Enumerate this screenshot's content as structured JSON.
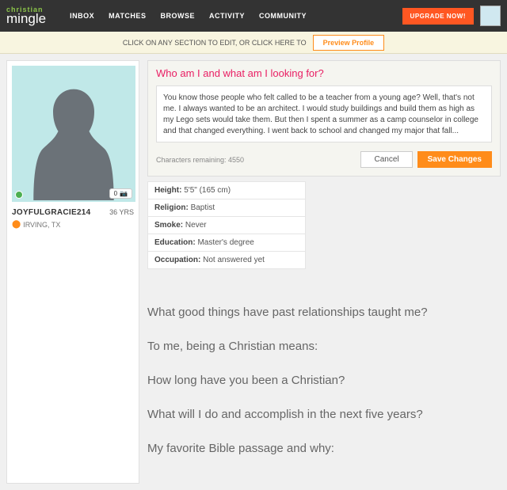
{
  "header": {
    "logo_top": "christian",
    "logo_bot": "mingle",
    "nav": [
      "INBOX",
      "MATCHES",
      "BROWSE",
      "ACTIVITY",
      "COMMUNITY"
    ],
    "upgrade": "UPGRADE NOW!"
  },
  "banner": {
    "text": "CLICK ON ANY SECTION TO EDIT, OR CLICK HERE TO",
    "preview": "Preview Profile"
  },
  "profile": {
    "photo_count": "0",
    "username": "JOYFULGRACIE214",
    "age": "36 YRS",
    "location": "IRVING, TX"
  },
  "editor": {
    "title": "Who am I and what am I looking for?",
    "text": "You know those people who felt called to be a teacher from a young age? Well, that's not me. I always wanted to be an architect. I would study buildings and build them as high as my Lego sets would take them. But then I spent a summer as a camp counselor in college and that changed everything. I went back to school and changed my major that fall...",
    "chars": "Characters remaining: 4550",
    "cancel": "Cancel",
    "save": "Save Changes"
  },
  "details": [
    {
      "label": "Height:",
      "val": "5'5\" (165 cm)"
    },
    {
      "label": "Religion:",
      "val": "Baptist"
    },
    {
      "label": "Smoke:",
      "val": "Never"
    },
    {
      "label": "Education:",
      "val": "Master's degree"
    },
    {
      "label": "Occupation:",
      "val": "Not answered yet"
    }
  ],
  "prompts": [
    "What good things have past relationships taught me?",
    "To me, being a Christian means:",
    "How long have you been a Christian?",
    "What will I do and accomplish in the next five years?",
    "My favorite Bible passage and why:"
  ]
}
